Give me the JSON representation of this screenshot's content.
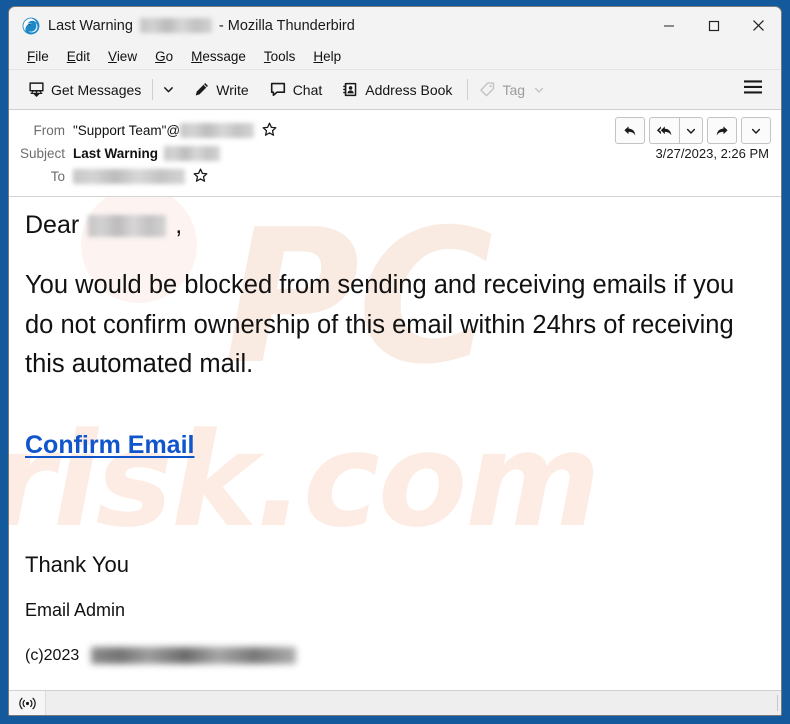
{
  "window": {
    "title_prefix": "Last Warning",
    "title_suffix": "- Mozilla Thunderbird",
    "app_icon": "thunderbird-icon",
    "controls": {
      "minimize": "minimize-icon",
      "maximize": "maximize-icon",
      "close": "close-icon"
    }
  },
  "menubar": {
    "items": [
      {
        "label": "File",
        "accesskey": "F"
      },
      {
        "label": "Edit",
        "accesskey": "E"
      },
      {
        "label": "View",
        "accesskey": "V"
      },
      {
        "label": "Go",
        "accesskey": "G"
      },
      {
        "label": "Message",
        "accesskey": "M"
      },
      {
        "label": "Tools",
        "accesskey": "T"
      },
      {
        "label": "Help",
        "accesskey": "H"
      }
    ]
  },
  "toolbar": {
    "get_messages_label": "Get Messages",
    "write_label": "Write",
    "chat_label": "Chat",
    "address_book_label": "Address Book",
    "tag_label": "Tag",
    "tag_disabled": true,
    "app_menu": "hamburger-menu-icon"
  },
  "message_header": {
    "from_label": "From",
    "from_value": "\"Support Team\"@",
    "from_redacted": true,
    "subject_label": "Subject",
    "subject_value": "Last Warning",
    "subject_redacted": true,
    "to_label": "To",
    "to_value": "",
    "to_redacted": true,
    "date": "3/27/2023, 2:26 PM",
    "actions": {
      "reply": "reply-icon",
      "reply_all": "reply-all-icon",
      "reply_all_more": "chevron-down-icon",
      "forward": "forward-icon",
      "more": "chevron-down-icon"
    }
  },
  "message_body": {
    "greeting": "Dear",
    "greeting_comma": ",",
    "paragraph": "You would be blocked from sending and receiving emails if you do not confirm ownership of this email within 24hrs of receiving this automated mail.",
    "link_text": "Confirm Email",
    "thanks": "Thank You",
    "signature": "Email Admin",
    "copyright": "(c)2023",
    "watermark_pc": "PC",
    "watermark_risk": "risk.com"
  },
  "statusbar": {
    "icon": "rss-broadcast-icon",
    "text": ""
  },
  "colors": {
    "frame": "#14599b",
    "chrome": "#f3f3f3",
    "link": "#1155cc",
    "label_grey": "#6d6d6d",
    "watermark": "#fbe9e0"
  }
}
